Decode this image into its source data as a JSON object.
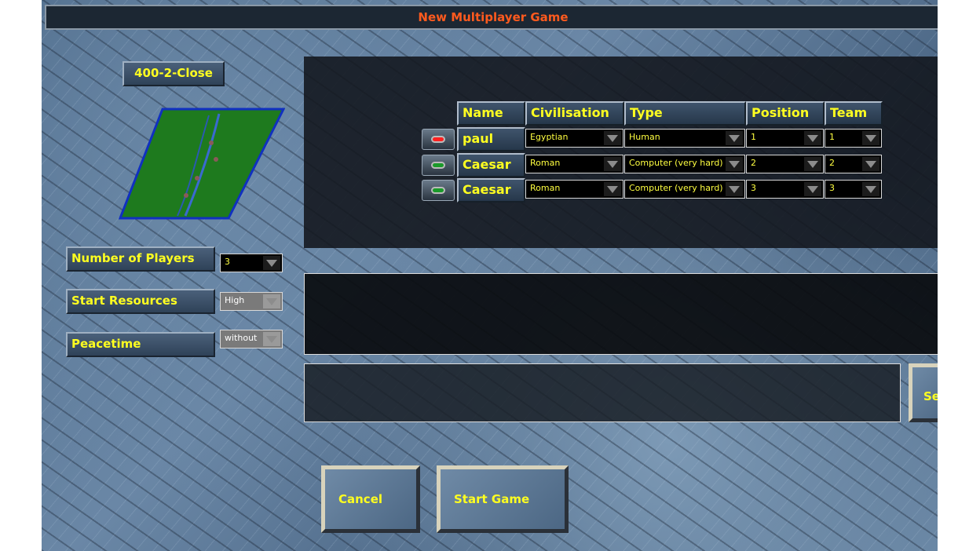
{
  "title": "New Multiplayer Game",
  "map": {
    "name": "400-2-Close"
  },
  "settings": [
    {
      "label": "Number of Players",
      "value": "3"
    },
    {
      "label": "Start Resources",
      "value": "High"
    },
    {
      "label": "Peacetime",
      "value": "without"
    }
  ],
  "table": {
    "headers": [
      "Name",
      "Civilisation",
      "Type",
      "Position",
      "Team"
    ],
    "rows": [
      {
        "led": "red",
        "name": "paul",
        "civ": "Egyptian",
        "type": "Human",
        "pos": "1",
        "team": "1"
      },
      {
        "led": "green",
        "name": "Caesar",
        "civ": "Roman",
        "type": "Computer (very hard)",
        "pos": "2",
        "team": "2"
      },
      {
        "led": "green",
        "name": "Caesar",
        "civ": "Roman",
        "type": "Computer (very hard)",
        "pos": "3",
        "team": "3"
      }
    ]
  },
  "chat": {
    "send_label": "Se",
    "input_value": ""
  },
  "buttons": {
    "cancel": "Cancel",
    "start": "Start Game"
  },
  "colors": {
    "title": "#ff5a1e",
    "label": "#ffff20",
    "led_red": "#ff2020",
    "led_green": "#1a9a2a"
  }
}
